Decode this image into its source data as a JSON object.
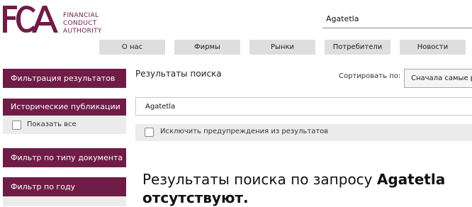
{
  "brand": {
    "logo_letters": "FCA",
    "name_lines": [
      "FINANCIAL",
      "CONDUCT",
      "AUTHORITY"
    ],
    "color": "#6f1d46"
  },
  "header": {
    "search_value": "Agatetla"
  },
  "nav": {
    "items": [
      "О нас",
      "Фирмы",
      "Рынки",
      "Потребители",
      "Новости"
    ]
  },
  "sidebar": {
    "filter_results": "Фильтрация результатов",
    "historical": "Исторические публикации",
    "show_all": "Показать все",
    "doc_type_filter": "Фильтр по типу документа",
    "year_filter": "Фильтр по году"
  },
  "main": {
    "results_title": "Результаты поиска",
    "sort_label": "Сортировать по:",
    "sort_value": "Сначала самые релевантные",
    "query_value": "Agatetla",
    "exclude_label": "Исключить предупреждения из результатов",
    "no_results_prefix": "Результаты поиска по запросу ",
    "no_results_query": "Agatetla",
    "no_results_suffix": "отсутствуют."
  }
}
